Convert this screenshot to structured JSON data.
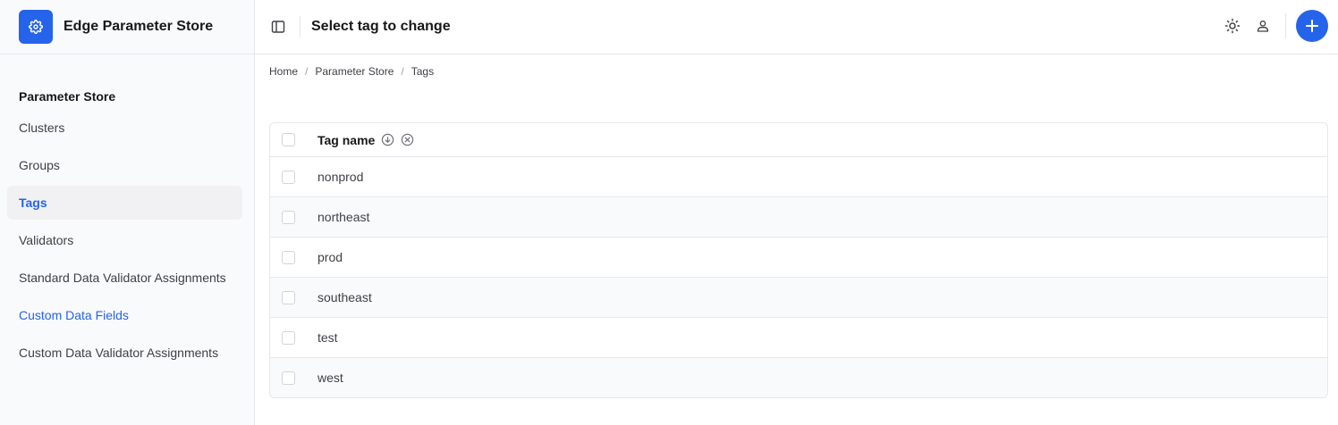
{
  "app": {
    "title": "Edge Parameter Store",
    "logo_icon": "gear-icon"
  },
  "colors": {
    "accent": "#2563eb",
    "sidebar_bg": "#f9fafb",
    "border": "#e5e7eb"
  },
  "sidebar": {
    "section_title": "Parameter Store",
    "items": [
      {
        "label": "Clusters",
        "state": "normal"
      },
      {
        "label": "Groups",
        "state": "normal"
      },
      {
        "label": "Tags",
        "state": "active"
      },
      {
        "label": "Validators",
        "state": "normal"
      },
      {
        "label": "Standard Data Validator Assignments",
        "state": "normal"
      },
      {
        "label": "Custom Data Fields",
        "state": "link"
      },
      {
        "label": "Custom Data Validator Assignments",
        "state": "normal"
      }
    ]
  },
  "header": {
    "title": "Select tag to change",
    "icons": [
      "sidebar-toggle-icon",
      "theme-sun-icon",
      "user-icon",
      "plus-icon"
    ]
  },
  "breadcrumb": [
    "Home",
    "Parameter Store",
    "Tags"
  ],
  "table": {
    "column": "Tag name",
    "sort_icons": [
      "sort-plus-icon",
      "sort-clear-icon"
    ],
    "rows": [
      "nonprod",
      "northeast",
      "prod",
      "southeast",
      "test",
      "west"
    ]
  }
}
